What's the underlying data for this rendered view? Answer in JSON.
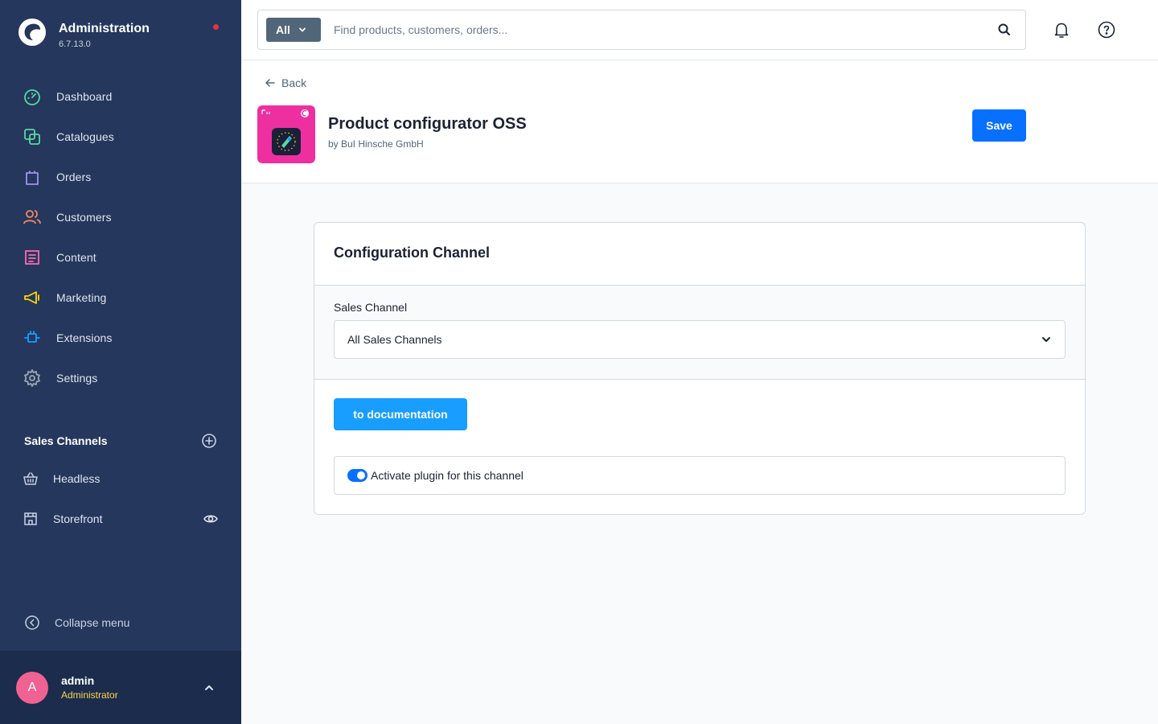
{
  "app": {
    "title": "Administration",
    "version": "6.7.13.0"
  },
  "nav": {
    "items": [
      {
        "label": "Dashboard",
        "icon": "dashboard-icon",
        "color": "#57d9a3"
      },
      {
        "label": "Catalogues",
        "icon": "catalogue-icon",
        "color": "#57d9a3"
      },
      {
        "label": "Orders",
        "icon": "orders-icon",
        "color": "#a092f0"
      },
      {
        "label": "Customers",
        "icon": "customers-icon",
        "color": "#f88962"
      },
      {
        "label": "Content",
        "icon": "content-icon",
        "color": "#ff68b4"
      },
      {
        "label": "Marketing",
        "icon": "marketing-icon",
        "color": "#ffd700"
      },
      {
        "label": "Extensions",
        "icon": "extensions-icon",
        "color": "#189eff"
      },
      {
        "label": "Settings",
        "icon": "settings-icon",
        "color": "#9aa8b5"
      }
    ]
  },
  "sales_channels": {
    "title": "Sales Channels",
    "items": [
      {
        "label": "Headless"
      },
      {
        "label": "Storefront"
      }
    ]
  },
  "sidebar": {
    "collapse_label": "Collapse menu"
  },
  "user": {
    "initial": "A",
    "name": "admin",
    "role": "Administrator"
  },
  "search": {
    "type_label": "All",
    "placeholder": "Find products, customers, orders..."
  },
  "page": {
    "back_label": "Back",
    "plugin_title": "Product configurator OSS",
    "plugin_vendor": "by BuI Hinsche GmbH",
    "save_label": "Save"
  },
  "card": {
    "title": "Configuration Channel",
    "sales_channel_label": "Sales Channel",
    "sales_channel_value": "All Sales Channels",
    "doc_button_label": "to documentation",
    "activate_label": "Activate plugin for this channel",
    "activate_on": true
  },
  "colors": {
    "sidebar_bg": "#25375c",
    "primary": "#0870ff",
    "doc_button": "#189eff"
  }
}
